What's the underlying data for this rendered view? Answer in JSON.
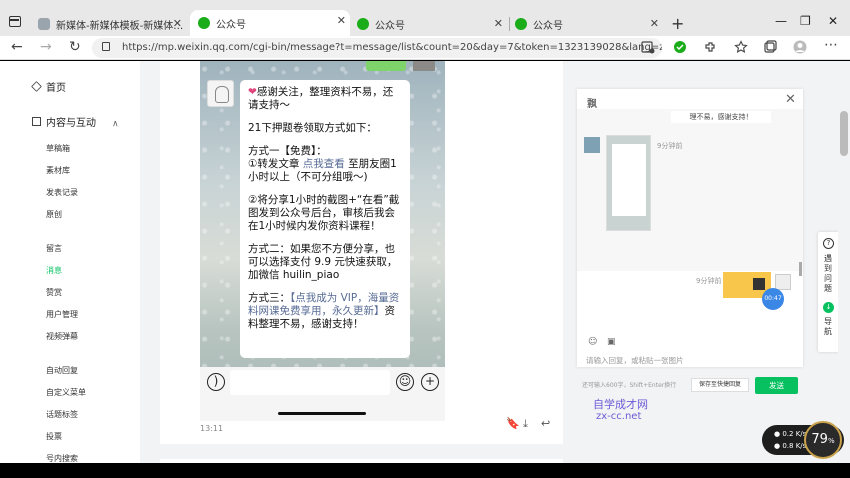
{
  "browser": {
    "tabs": [
      {
        "title": "新媒体-新媒体模板-新媒体图片…",
        "favicon": "gray"
      },
      {
        "title": "公众号",
        "favicon": "green"
      },
      {
        "title": "公众号",
        "favicon": "green"
      },
      {
        "title": "公众号",
        "favicon": "green"
      }
    ],
    "url": "https://mp.weixin.qq.com/cgi-bin/message?t=message/list&count=20&day=7&token=1323139028&lang=zh_CN",
    "icons": [
      "window-icon",
      "back-icon",
      "forward-icon",
      "reload-icon",
      "new-tab-icon",
      "minimize-icon",
      "maximize-icon",
      "close-icon"
    ]
  },
  "sidebar": {
    "home": "首页",
    "content_section": "内容与互动",
    "items": [
      "草稿箱",
      "素材库",
      "发表记录",
      "原创",
      "留言",
      "消息",
      "赞赏",
      "用户管理",
      "视频弹幕",
      "自动回复",
      "自定义菜单",
      "话题标签",
      "投票",
      "号内搜索"
    ],
    "active": "消息"
  },
  "message": {
    "line1": "感谢关注，整理资料不易，还请支持～",
    "line2": "21下押题卷领取方式如下：",
    "m1_title": "方式一【免费】：",
    "m1_a": "①转发文章 ",
    "m1_link": "点我查看",
    "m1_b": " 至朋友圈1小时以上（不可分组哦～)",
    "m2": "②将分享1小时的截图+“在看”截图发到公众号后台，审核后我会在1小时候内发你资料课程！",
    "m3": "方式二：如果您不方便分享，也可以选择支付 9.9 元快速获取，加微信 huilin_piao",
    "m4_a": "方式三：",
    "m4_link": "【点我成为 VIP，海量资料网课免费享用，永久更新】",
    "m4_b": "资料整理不易，感谢支持！",
    "timestamp": "13:11"
  },
  "panel": {
    "title": "飘",
    "top_bubble": "理不易，感谢支持！",
    "time1": "9分钟前",
    "time2": "9分钟前",
    "badge": "00:47",
    "input_placeholder": "请输入回复，或粘贴一张图片",
    "hint": "还可输入600字，Shift+Enter换行",
    "save_label": "保存至快捷回复",
    "send_label": "发送"
  },
  "floatbar": {
    "help_label": "遇到问题",
    "nav_label": "导航"
  },
  "watermark": {
    "line1": "自学成才网",
    "line2": "zx-cc.net"
  },
  "speed": {
    "up": "0.2",
    "down": "0.8",
    "unit": "K/s",
    "percent": "79"
  },
  "colors": {
    "accent": "#07c160",
    "link": "#576b95"
  }
}
